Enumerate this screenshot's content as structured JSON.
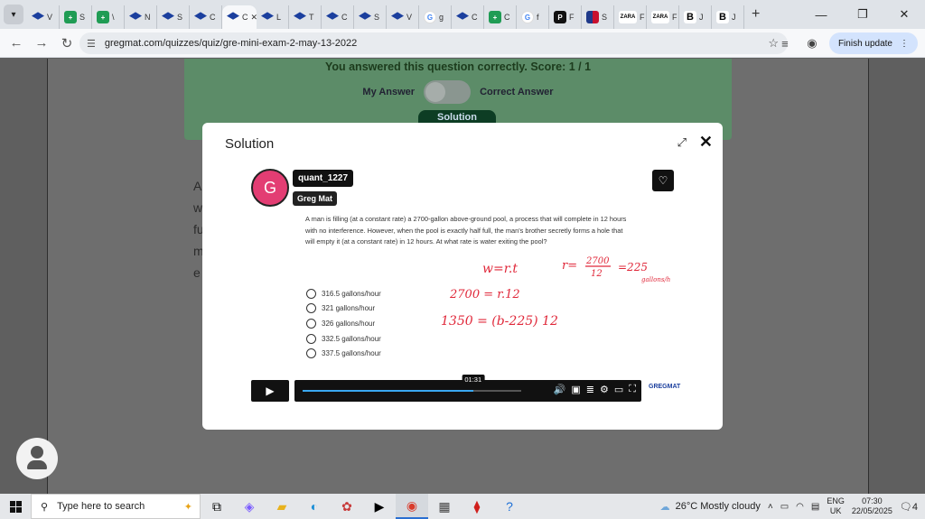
{
  "browser": {
    "tabs": [
      {
        "label": "V",
        "icon": "blue"
      },
      {
        "label": "S",
        "icon": "sheets"
      },
      {
        "label": "\\",
        "icon": "sheets"
      },
      {
        "label": "N",
        "icon": "blue"
      },
      {
        "label": "S",
        "icon": "blue"
      },
      {
        "label": "C",
        "icon": "blue"
      },
      {
        "label": "C",
        "icon": "blue",
        "active": true
      },
      {
        "label": "L",
        "icon": "blue"
      },
      {
        "label": "T",
        "icon": "blue"
      },
      {
        "label": "C",
        "icon": "blue"
      },
      {
        "label": "S",
        "icon": "blue"
      },
      {
        "label": "V",
        "icon": "blue"
      },
      {
        "label": "g",
        "icon": "google"
      },
      {
        "label": "C",
        "icon": "blue"
      },
      {
        "label": "C",
        "icon": "sheets"
      },
      {
        "label": "f",
        "icon": "google"
      },
      {
        "label": "F",
        "icon": "dark"
      },
      {
        "label": "S",
        "icon": "flag"
      },
      {
        "label": "F",
        "icon": "zara"
      },
      {
        "label": "F",
        "icon": "zara"
      },
      {
        "label": "J",
        "icon": "bold"
      },
      {
        "label": "J",
        "icon": "bold"
      }
    ],
    "url": "gregmat.com/quizzes/quiz/gre-mini-exam-2-may-13-2022",
    "finish_update": "Finish update"
  },
  "result": {
    "message": "You answered this question correctly. Score: 1 / 1",
    "my_answer": "My Answer",
    "correct_answer": "Correct Answer",
    "solution_tab": "Solution"
  },
  "background_text": [
    "A",
    "w",
    "fu",
    "m",
    "e"
  ],
  "modal": {
    "title": "Solution",
    "username": "quant_1227",
    "badge": "Greg Mat",
    "avatar_letter": "G",
    "question": "A man is filling (at a constant rate) a 2700-gallon above-ground pool, a process that will complete in 12 hours with no interference. However, when the pool is exactly half full, the man's brother secretly forms a hole that will empty it (at a constant rate) in 12 hours. At what rate is water exiting the pool?",
    "options": [
      "316.5 gallons/hour",
      "321 gallons/hour",
      "326 gallons/hour",
      "332.5 gallons/hour",
      "337.5 gallons/hour"
    ],
    "handwriting": {
      "line1": "w=r.t",
      "line2_left": "r=",
      "line2_num": "2700",
      "line2_den": "12",
      "line2_result": "=225",
      "line2_unit": "gallons/h",
      "line3": "2700 = r.12",
      "line4": "1350 = (b-225) 12"
    },
    "video": {
      "time": "01:31",
      "progress": 0.78,
      "brand": "GREGMAT"
    }
  },
  "taskbar": {
    "search_placeholder": "Type here to search",
    "weather": "26°C  Mostly cloudy",
    "lang1": "ENG",
    "lang2": "UK",
    "time": "07:30",
    "date": "22/05/2025",
    "notifications": "4"
  }
}
